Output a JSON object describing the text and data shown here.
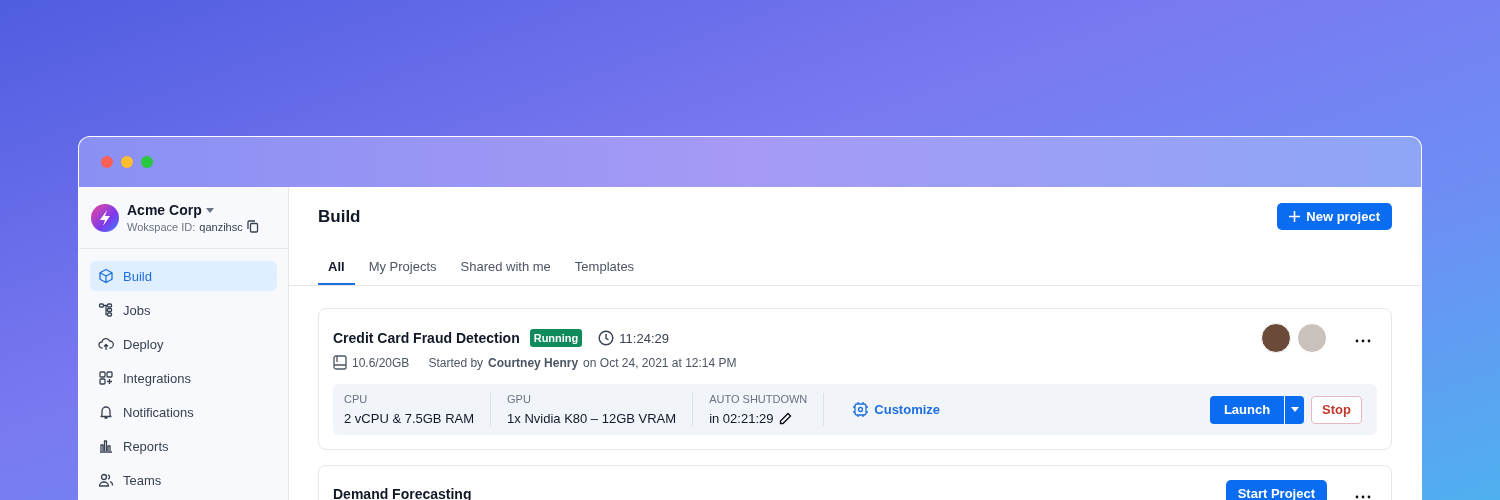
{
  "workspace": {
    "name": "Acme Corp",
    "id_label": "Wokspace ID:",
    "id": "qanzihsc"
  },
  "sidebar": {
    "items": [
      {
        "label": "Build",
        "selected": true
      },
      {
        "label": "Jobs",
        "selected": false
      },
      {
        "label": "Deploy",
        "selected": false
      },
      {
        "label": "Integrations",
        "selected": false
      },
      {
        "label": "Notifications",
        "selected": false
      },
      {
        "label": "Reports",
        "selected": false
      },
      {
        "label": "Teams",
        "selected": false
      }
    ]
  },
  "header": {
    "title": "Build",
    "new_button": "New project"
  },
  "tabs": [
    {
      "label": "All",
      "selected": true
    },
    {
      "label": "My Projects",
      "selected": false
    },
    {
      "label": "Shared with me",
      "selected": false
    },
    {
      "label": "Templates",
      "selected": false
    }
  ],
  "projects": [
    {
      "kind": "running",
      "name": "Credit Card Fraud Detection",
      "status": "Running",
      "time": "11:24:29",
      "storage": "10.6/20GB",
      "started_by": "Started by",
      "user": "Courtney Henry",
      "date": "on Oct 24, 2021 at 12:14 PM",
      "specs": [
        {
          "label": "CPU",
          "value": "2 vCPU & 7.5GB RAM"
        },
        {
          "label": "GPU",
          "value": "1x Nvidia K80 – 12GB VRAM"
        },
        {
          "label": "AUTO SHUTDOWN",
          "value": "in 02:21:29"
        }
      ],
      "customize": "Customize",
      "launch": "Launch",
      "stop": "Stop"
    },
    {
      "kind": "idle",
      "name": "Demand Forecasting",
      "start": "Start Project"
    }
  ]
}
